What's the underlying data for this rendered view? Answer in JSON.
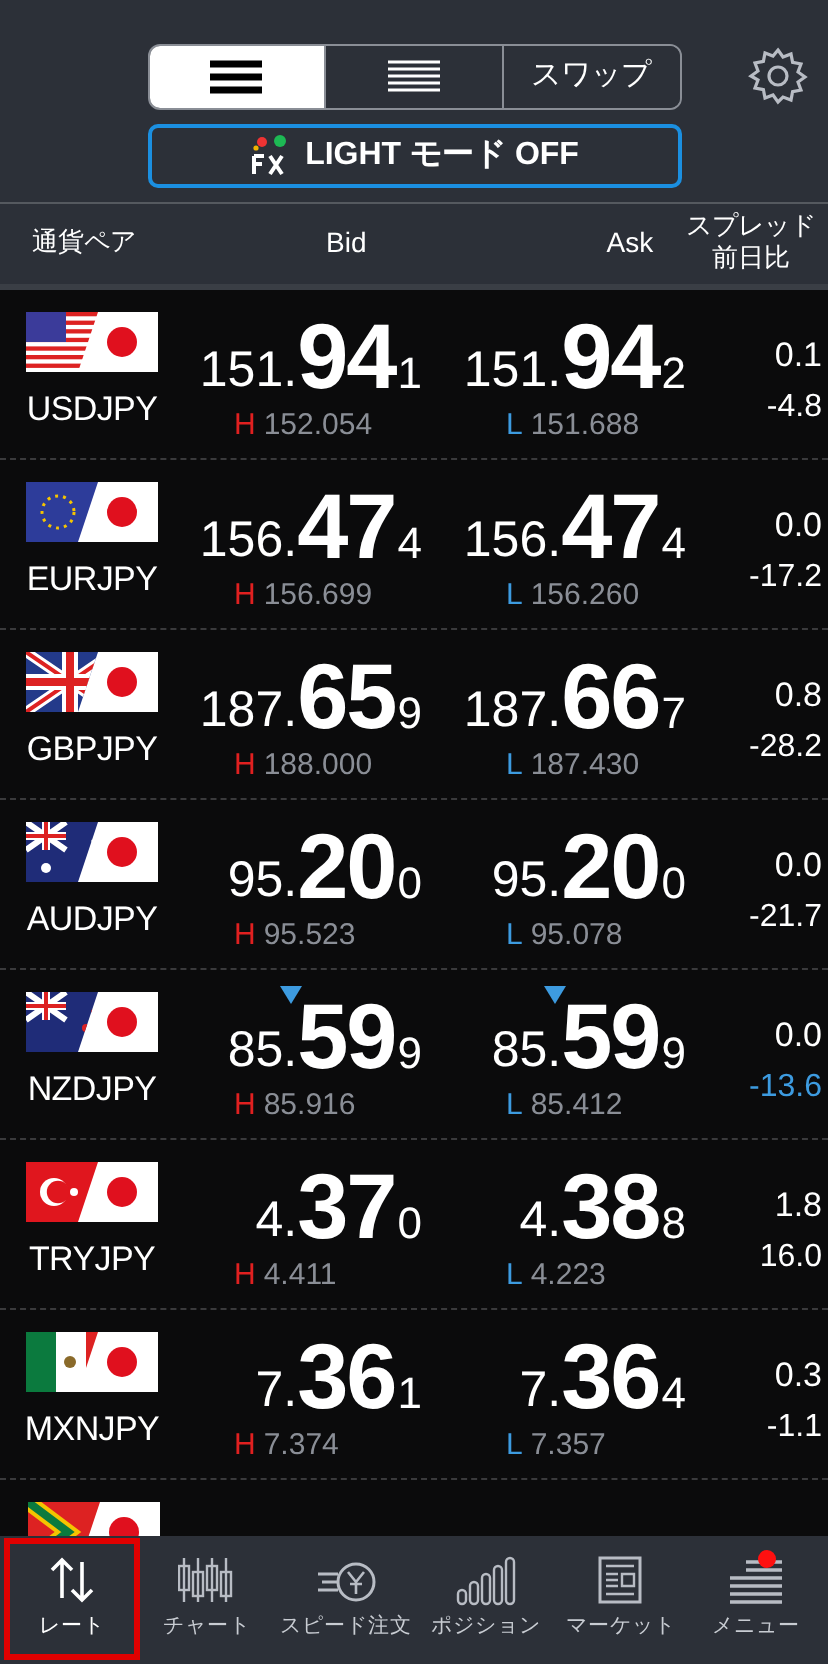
{
  "view_toggle": [
    {
      "kind": "wide",
      "selected": true
    },
    {
      "kind": "compact",
      "selected": false
    },
    {
      "kind": "text",
      "label": "スワップ",
      "selected": false
    }
  ],
  "light_mode_button": {
    "label": "LIGHT モード OFF"
  },
  "columns": {
    "pair": "通貨ペア",
    "bid": "Bid",
    "ask": "Ask",
    "spread": [
      "スプレッド",
      "前日比"
    ]
  },
  "rows": [
    {
      "kind": "us",
      "pair": "USDJPY",
      "falling": false,
      "bid": {
        "head": "151.",
        "big": "94",
        "tail": "1"
      },
      "high": {
        "mark": "H",
        "value": "152.054"
      },
      "ask": {
        "head": "151.",
        "big": "94",
        "tail": "2"
      },
      "low": {
        "mark": "L",
        "value": "151.688"
      },
      "spread": "0.1",
      "change": "-4.8",
      "color": "#ffffff"
    },
    {
      "kind": "eu",
      "pair": "EURJPY",
      "falling": false,
      "bid": {
        "head": "156.",
        "big": "47",
        "tail": "4"
      },
      "high": {
        "mark": "H",
        "value": "156.699"
      },
      "ask": {
        "head": "156.",
        "big": "47",
        "tail": "4"
      },
      "low": {
        "mark": "L",
        "value": "156.260"
      },
      "spread": "0.0",
      "change": "-17.2",
      "color": "#ffffff"
    },
    {
      "kind": "gb",
      "pair": "GBPJPY",
      "falling": false,
      "bid": {
        "head": "187.",
        "big": "65",
        "tail": "9"
      },
      "high": {
        "mark": "H",
        "value": "188.000"
      },
      "ask": {
        "head": "187.",
        "big": "66",
        "tail": "7"
      },
      "low": {
        "mark": "L",
        "value": "187.430"
      },
      "spread": "0.8",
      "change": "-28.2",
      "color": "#ffffff"
    },
    {
      "kind": "au",
      "pair": "AUDJPY",
      "falling": false,
      "bid": {
        "head": "95.",
        "big": "20",
        "tail": "0"
      },
      "high": {
        "mark": "H",
        "value": "95.523"
      },
      "ask": {
        "head": "95.",
        "big": "20",
        "tail": "0"
      },
      "low": {
        "mark": "L",
        "value": "95.078"
      },
      "spread": "0.0",
      "change": "-21.7",
      "color": "#ffffff"
    },
    {
      "kind": "nz",
      "pair": "NZDJPY",
      "falling": true,
      "bid": {
        "head": "85.",
        "big": "59",
        "tail": "9"
      },
      "high": {
        "mark": "H",
        "value": "85.916"
      },
      "ask": {
        "head": "85.",
        "big": "59",
        "tail": "9"
      },
      "low": {
        "mark": "L",
        "value": "85.412"
      },
      "spread": "0.0",
      "change": "-13.6",
      "color": "#3d9be0"
    },
    {
      "kind": "tr",
      "pair": "TRYJPY",
      "falling": false,
      "bid": {
        "head": "4.",
        "big": "37",
        "tail": "0"
      },
      "high": {
        "mark": "H",
        "value": "4.411"
      },
      "ask": {
        "head": "4.",
        "big": "38",
        "tail": "8"
      },
      "low": {
        "mark": "L",
        "value": "4.223"
      },
      "spread": "1.8",
      "change": "16.0",
      "color": "#ffffff"
    },
    {
      "kind": "mx",
      "pair": "MXNJPY",
      "falling": false,
      "bid": {
        "head": "7.",
        "big": "36",
        "tail": "1"
      },
      "high": {
        "mark": "H",
        "value": "7.374"
      },
      "ask": {
        "head": "7.",
        "big": "36",
        "tail": "4"
      },
      "low": {
        "mark": "L",
        "value": "7.357"
      },
      "spread": "0.3",
      "change": "-1.1",
      "color": "#ffffff"
    }
  ],
  "partial_row": {
    "kind": "za"
  },
  "tabs": [
    {
      "kind": "rate",
      "label": "レート",
      "selected": true,
      "badge": false
    },
    {
      "kind": "chart",
      "label": "チャート",
      "selected": false,
      "badge": false
    },
    {
      "kind": "speed",
      "label": "スピード注文",
      "selected": false,
      "badge": false
    },
    {
      "kind": "position",
      "label": "ポジション",
      "selected": false,
      "badge": false
    },
    {
      "kind": "market",
      "label": "マーケット",
      "selected": false,
      "badge": false
    },
    {
      "kind": "menu",
      "label": "メニュー",
      "selected": false,
      "badge": true
    }
  ]
}
